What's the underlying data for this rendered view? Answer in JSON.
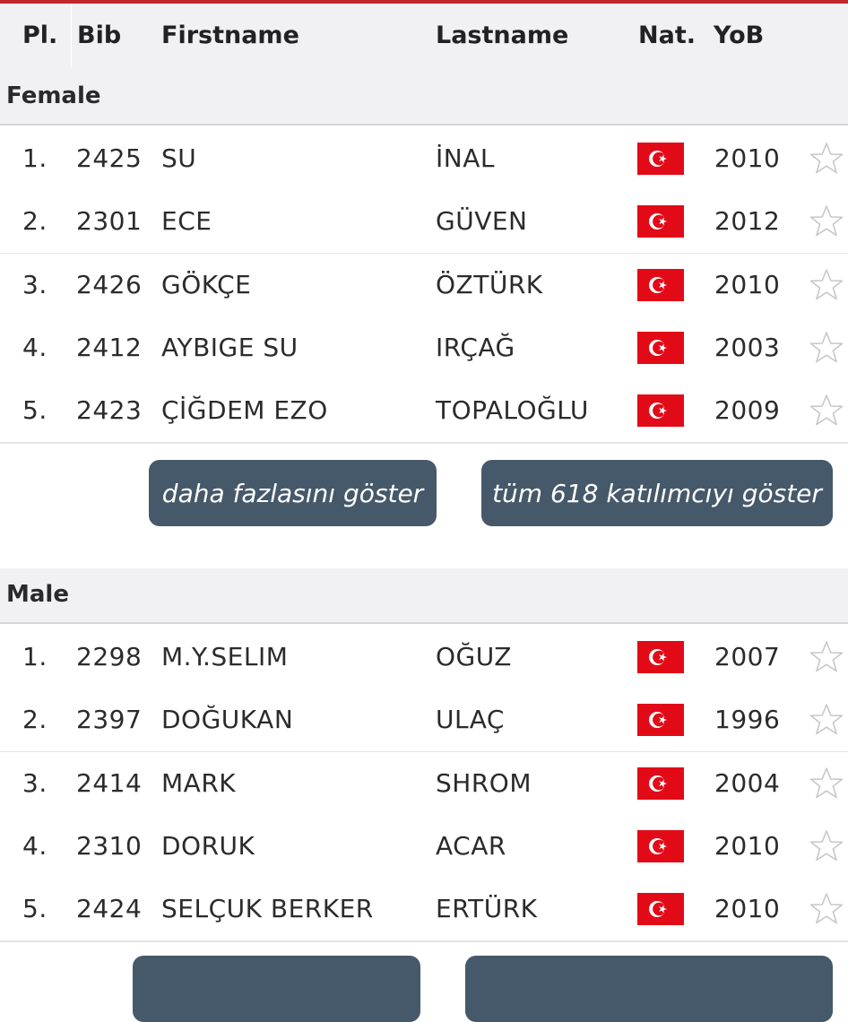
{
  "columns": {
    "place": "Pl.",
    "bib": "Bib",
    "firstname": "Firstname",
    "lastname": "Lastname",
    "nat": "Nat.",
    "yob": "YoB"
  },
  "groups": {
    "female": {
      "title": "Female",
      "rows": [
        {
          "place": "1.",
          "bib": "2425",
          "firstname": "SU",
          "lastname": "İNAL",
          "nat": "turkey-flag-icon",
          "yob": "2010"
        },
        {
          "place": "2.",
          "bib": "2301",
          "firstname": "ECE",
          "lastname": "GÜVEN",
          "nat": "turkey-flag-icon",
          "yob": "2012"
        },
        {
          "place": "3.",
          "bib": "2426",
          "firstname": "GÖKÇE",
          "lastname": "ÖZTÜRK",
          "nat": "turkey-flag-icon",
          "yob": "2010"
        },
        {
          "place": "4.",
          "bib": "2412",
          "firstname": "AYBIGE SU",
          "lastname": "IRÇAĞ",
          "nat": "turkey-flag-icon",
          "yob": "2003"
        },
        {
          "place": "5.",
          "bib": "2423",
          "firstname": "ÇİĞDEM EZO",
          "lastname": "TOPALOĞLU",
          "nat": "turkey-flag-icon",
          "yob": "2009"
        }
      ],
      "show_more_label": "daha fazlasını göster",
      "show_all_label": "tüm 618 katılımcıyı göster"
    },
    "male": {
      "title": "Male",
      "rows": [
        {
          "place": "1.",
          "bib": "2298",
          "firstname": "M.Y.SELIM",
          "lastname": "OĞUZ",
          "nat": "turkey-flag-icon",
          "yob": "2007"
        },
        {
          "place": "2.",
          "bib": "2397",
          "firstname": "DOĞUKAN",
          "lastname": "ULAÇ",
          "nat": "turkey-flag-icon",
          "yob": "1996"
        },
        {
          "place": "3.",
          "bib": "2414",
          "firstname": "MARK",
          "lastname": "SHROM",
          "nat": "turkey-flag-icon",
          "yob": "2004"
        },
        {
          "place": "4.",
          "bib": "2310",
          "firstname": "DORUK",
          "lastname": "ACAR",
          "nat": "turkey-flag-icon",
          "yob": "2010"
        },
        {
          "place": "5.",
          "bib": "2424",
          "firstname": "SELÇUK BERKER",
          "lastname": "ERTÜRK",
          "nat": "turkey-flag-icon",
          "yob": "2010"
        }
      ]
    }
  },
  "colors": {
    "accent": "#c0272d",
    "button": "#46596a",
    "header_bg": "#f1f1f3",
    "flag_red": "#e30a17"
  },
  "icons": {
    "favorite": "star-outline-icon",
    "nationality": "turkey-flag-icon"
  }
}
